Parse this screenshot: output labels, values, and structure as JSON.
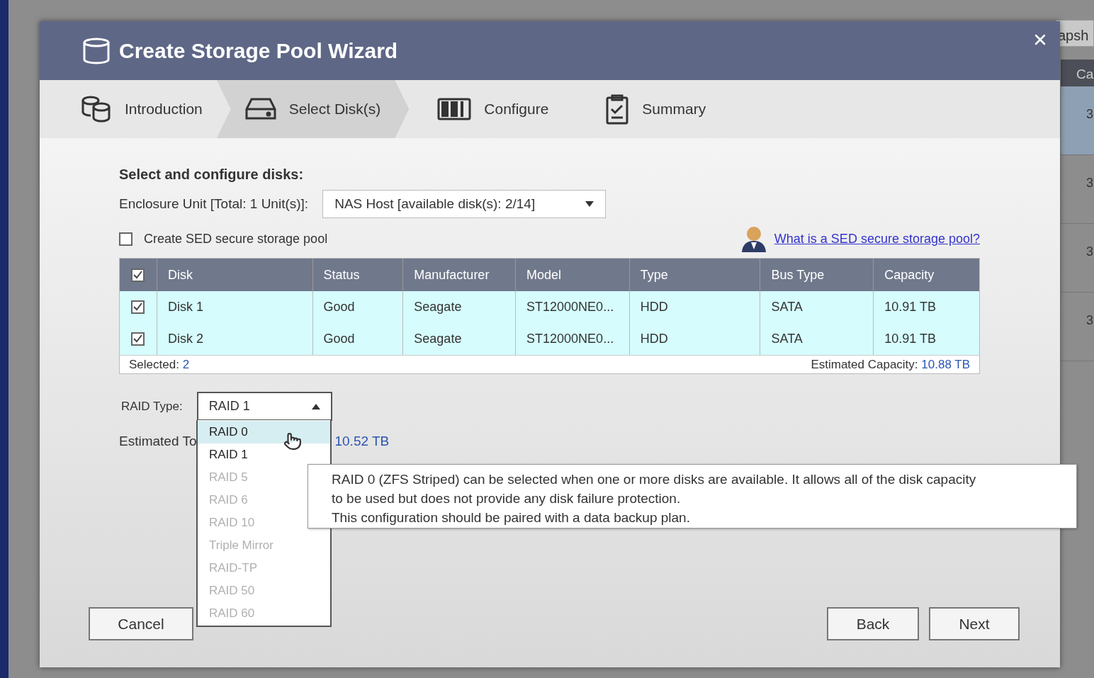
{
  "background": {
    "button_text": "apsh",
    "column_header": "Ca",
    "rows": [
      {
        "cell": "3",
        "selected": true
      },
      {
        "cell": "3",
        "selected": false
      },
      {
        "cell": "3",
        "selected": false
      },
      {
        "cell": "3",
        "selected": false
      }
    ]
  },
  "dialog": {
    "title": "Create Storage Pool Wizard"
  },
  "steps": [
    {
      "label": "Introduction",
      "kind": "introduction",
      "selected": false
    },
    {
      "label": "Select Disk(s)",
      "kind": "disks",
      "selected": true
    },
    {
      "label": "Configure",
      "kind": "configure",
      "selected": false
    },
    {
      "label": "Summary",
      "kind": "summary",
      "selected": false
    }
  ],
  "section_title": "Select and configure disks:",
  "enclosure": {
    "label": "Enclosure Unit [Total: 1 Unit(s)]:",
    "value": "NAS Host [available disk(s): 2/14]"
  },
  "sed": {
    "label": "Create SED secure storage pool",
    "checked": false
  },
  "help_link": "What is a SED secure storage pool?",
  "table": {
    "all_checked": true,
    "columns": [
      "Disk",
      "Status",
      "Manufacturer",
      "Model",
      "Type",
      "Bus Type",
      "Capacity"
    ],
    "rows": [
      {
        "checked": true,
        "cells": [
          "Disk 1",
          "Good",
          "Seagate",
          "ST12000NE0...",
          "HDD",
          "SATA",
          "10.91 TB"
        ]
      },
      {
        "checked": true,
        "cells": [
          "Disk 2",
          "Good",
          "Seagate",
          "ST12000NE0...",
          "HDD",
          "SATA",
          "10.91 TB"
        ]
      }
    ]
  },
  "selected": {
    "label": "Selected:",
    "value": "2"
  },
  "estimated_capacity": {
    "label": "Estimated Capacity:",
    "value": "10.88 TB"
  },
  "raid": {
    "label": "RAID Type:",
    "value": "RAID 1",
    "options": [
      {
        "label": "RAID 0",
        "highlighted": true,
        "disabled": false
      },
      {
        "label": "RAID 1",
        "highlighted": false,
        "disabled": false
      },
      {
        "label": "RAID 5",
        "highlighted": false,
        "disabled": true
      },
      {
        "label": "RAID 6",
        "highlighted": false,
        "disabled": true
      },
      {
        "label": "RAID 10",
        "highlighted": false,
        "disabled": true
      },
      {
        "label": "Triple Mirror",
        "highlighted": false,
        "disabled": true
      },
      {
        "label": "RAID-TP",
        "highlighted": false,
        "disabled": true
      },
      {
        "label": "RAID 50",
        "highlighted": false,
        "disabled": true
      },
      {
        "label": "RAID 60",
        "highlighted": false,
        "disabled": true
      }
    ]
  },
  "estimated_total": {
    "label": "Estimated To",
    "value": "10.52 TB"
  },
  "tooltip": [
    "RAID 0 (ZFS Striped) can be selected when one or more disks are available. It allows all of the disk capacity",
    "to be used but does not provide any disk failure protection.",
    "This configuration should be paired with a data backup plan."
  ],
  "buttons": {
    "cancel": "Cancel",
    "back": "Back",
    "next": "Next"
  }
}
